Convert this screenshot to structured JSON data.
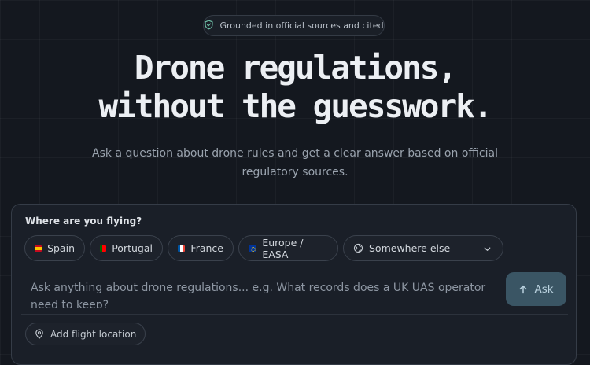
{
  "badge": {
    "text": "Grounded in official sources and cited",
    "icon": "shield-check-icon"
  },
  "hero": {
    "title_line1": "Drone regulations,",
    "title_line2": "without the guesswork.",
    "subtitle": "Ask a question about drone rules and get a clear answer based on official regulatory sources."
  },
  "card": {
    "title": "Where are you flying?",
    "locations": [
      {
        "label": "Spain",
        "icon": "spain-flag-icon"
      },
      {
        "label": "Portugal",
        "icon": "portugal-flag-icon"
      },
      {
        "label": "France",
        "icon": "france-flag-icon"
      },
      {
        "label": "Europe / EASA",
        "icon": "eu-flag-icon"
      },
      {
        "label": "Somewhere else",
        "icon": "globe-icon"
      }
    ],
    "query_placeholder": "Ask anything about drone regulations... e.g. What records does a UK UAS operator need to keep?",
    "ask_label": "Ask",
    "add_location_label": "Add flight location"
  },
  "colors": {
    "background": "#14181f",
    "card": "#1a1f28",
    "accent": "#3a5564",
    "badge_icon": "#6fc1a8"
  }
}
